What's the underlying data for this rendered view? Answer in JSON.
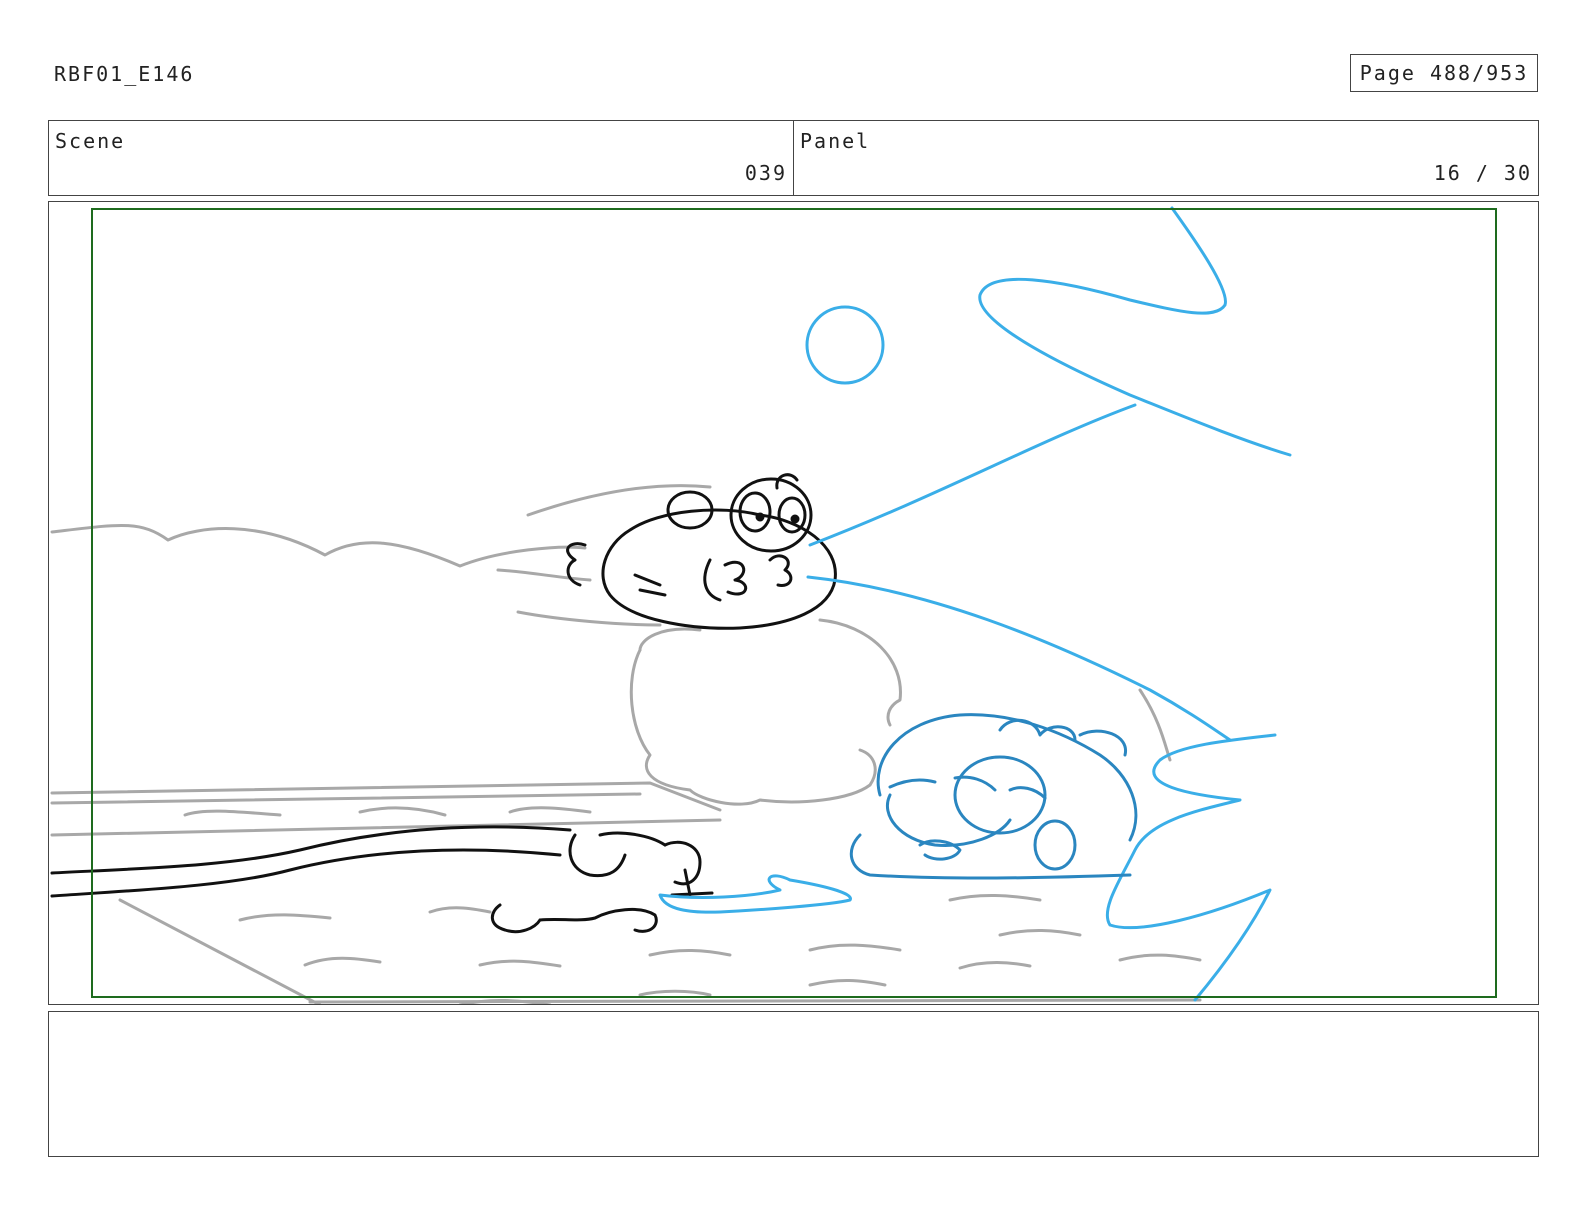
{
  "header": {
    "doc_id": "RBF01_E146",
    "page": "Page 488/953"
  },
  "info": {
    "scene_label": "Scene",
    "scene_value": "039",
    "panel_label": "Panel",
    "panel_value": "16 / 30"
  },
  "colors": {
    "black_ink": "#111111",
    "grey_ink": "#a8a8a8",
    "light_blue_ink": "#3aaee8",
    "dark_blue_ink": "#2a86c0",
    "safe_frame": "#1e6b1e"
  },
  "notes": ""
}
